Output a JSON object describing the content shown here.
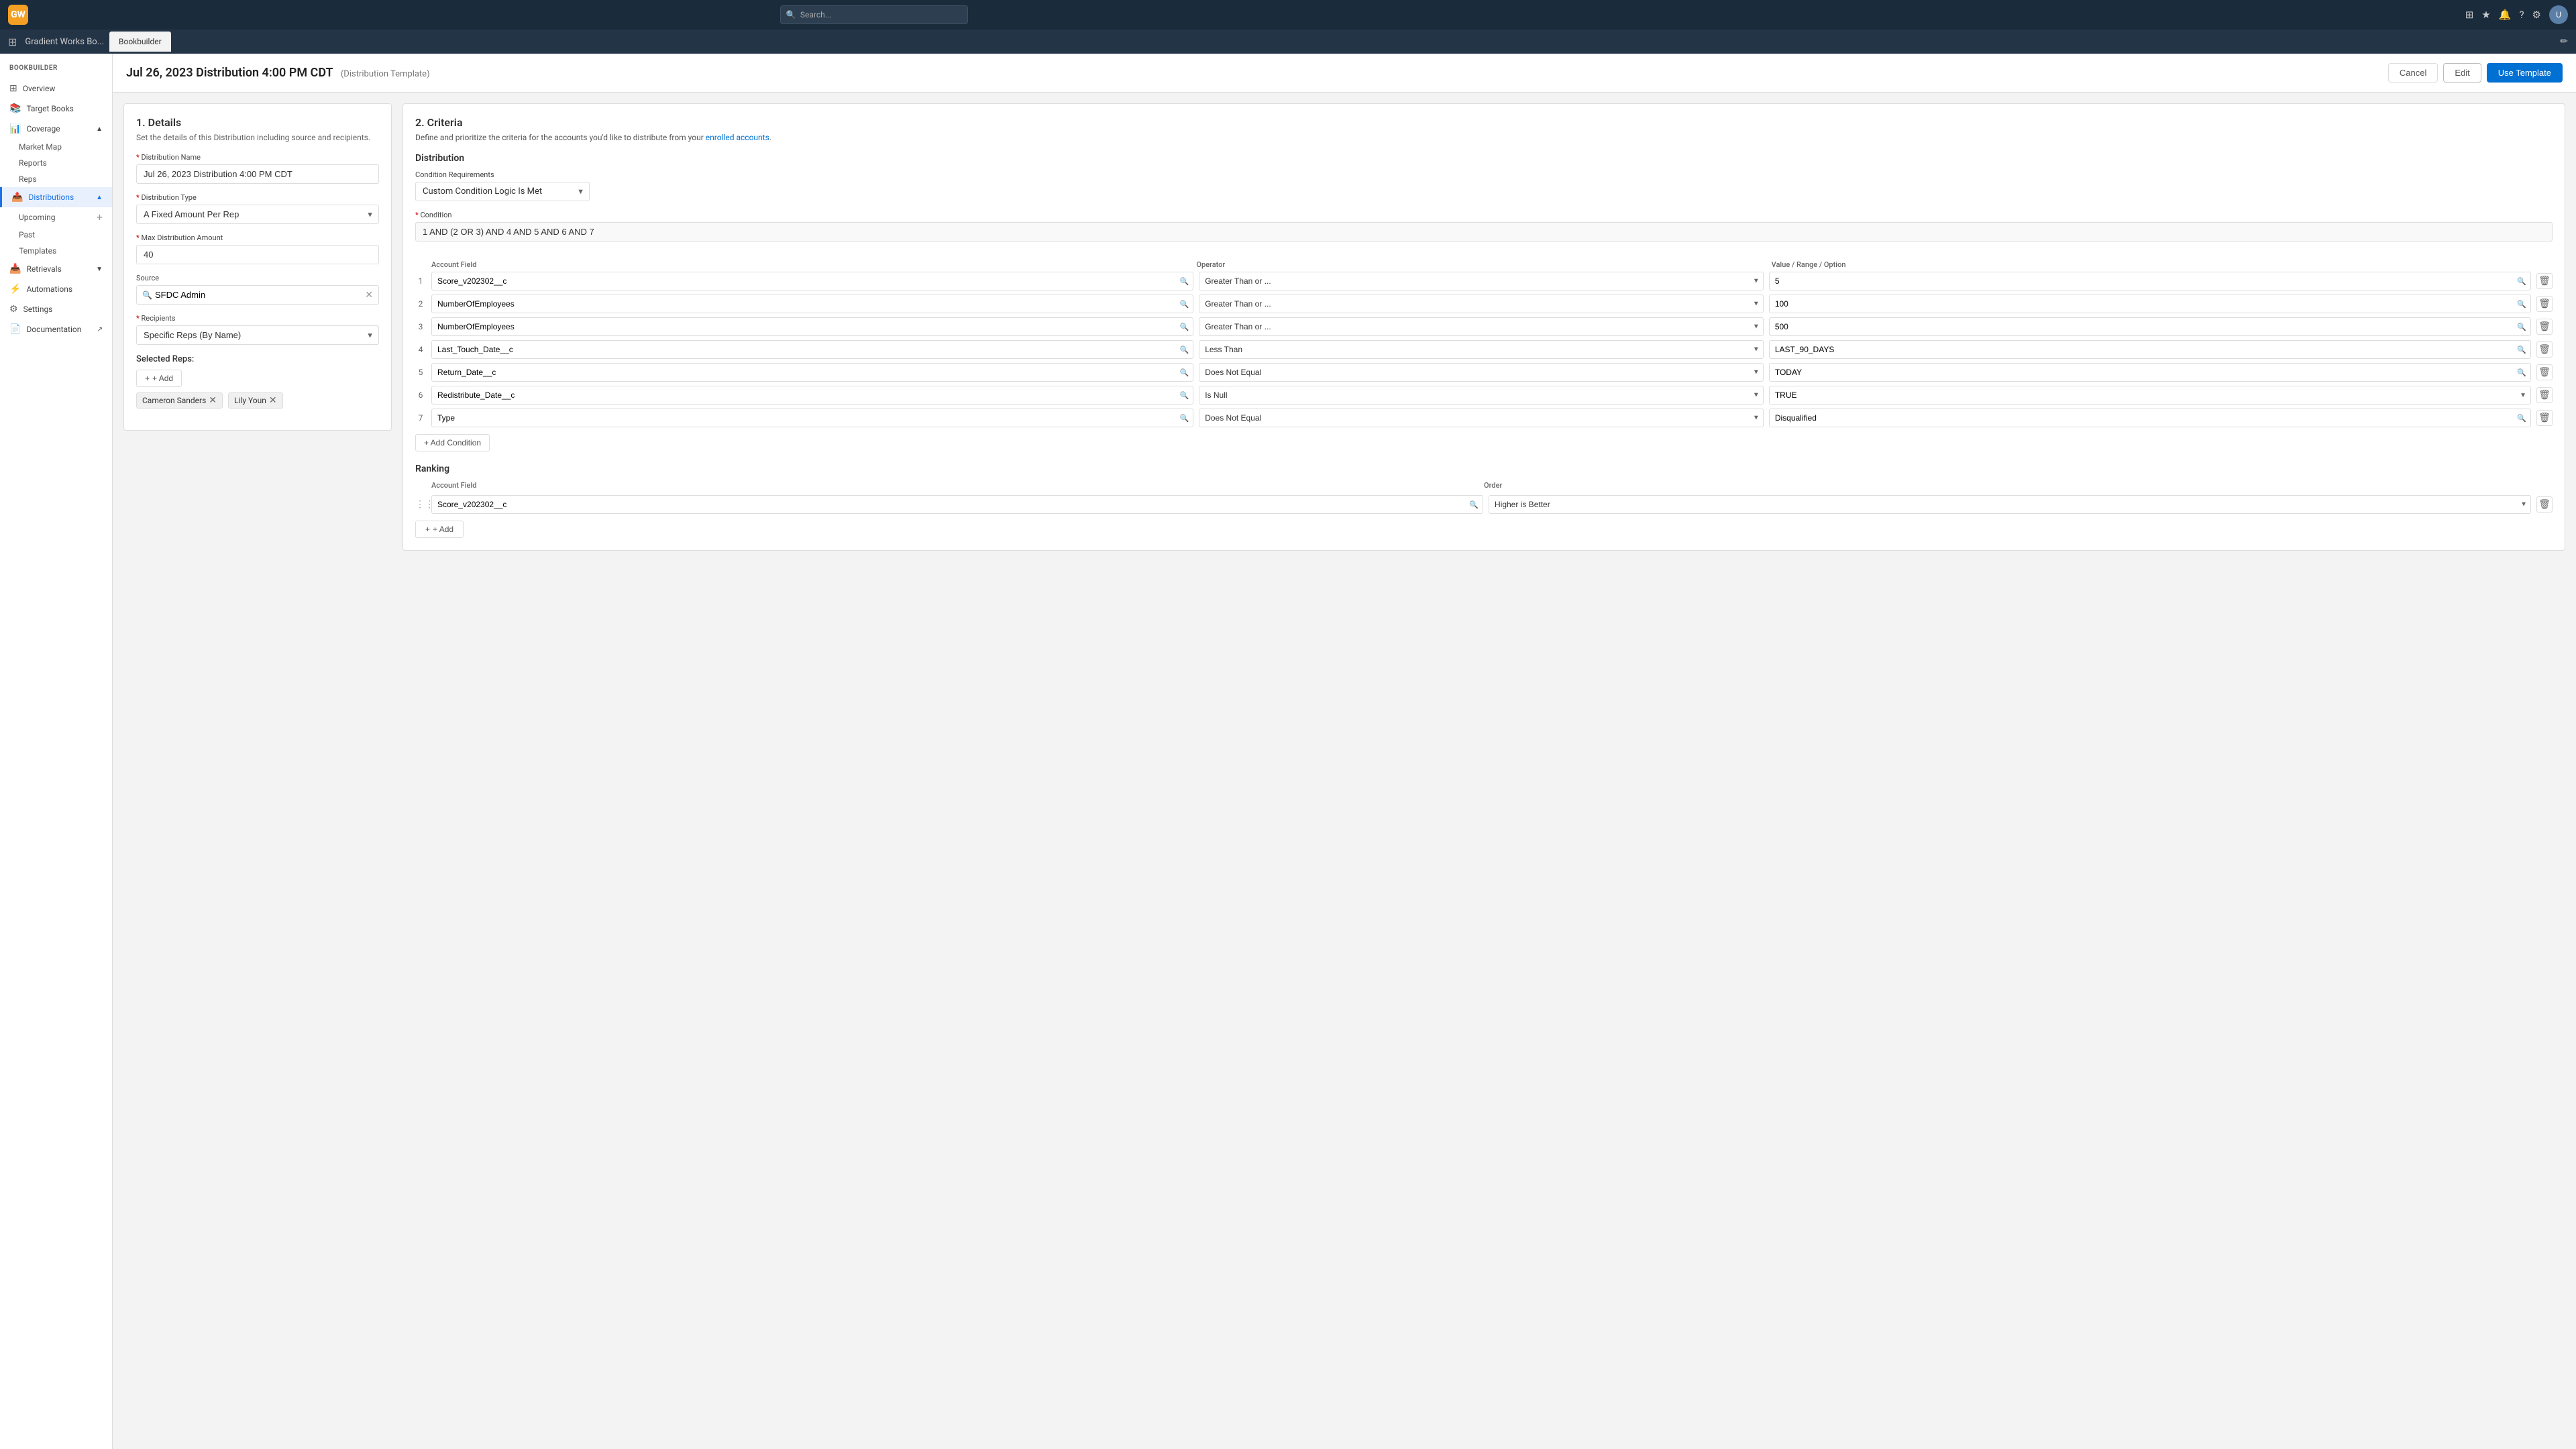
{
  "topNav": {
    "logoText": "GW",
    "searchPlaceholder": "Search...",
    "appName": "Gradient Works Bo...",
    "tabName": "Bookbuilder"
  },
  "header": {
    "title": "Jul 26, 2023 Distribution 4:00 PM CDT",
    "subtitle": "(Distribution Template)",
    "cancelLabel": "Cancel",
    "editLabel": "Edit",
    "useTemplateLabel": "Use Template"
  },
  "sidebar": {
    "heading": "BOOKBUILDER",
    "items": [
      {
        "id": "overview",
        "label": "Overview",
        "icon": "⊞"
      },
      {
        "id": "target-books",
        "label": "Target Books",
        "icon": "📚"
      },
      {
        "id": "coverage",
        "label": "Coverage",
        "icon": "📊",
        "expanded": true,
        "children": [
          {
            "id": "market-map",
            "label": "Market Map"
          },
          {
            "id": "reports",
            "label": "Reports"
          },
          {
            "id": "reps",
            "label": "Reps"
          }
        ]
      },
      {
        "id": "distributions",
        "label": "Distributions",
        "icon": "📤",
        "active": true,
        "expanded": true,
        "children": [
          {
            "id": "upcoming",
            "label": "Upcoming"
          },
          {
            "id": "past",
            "label": "Past"
          },
          {
            "id": "templates",
            "label": "Templates"
          }
        ]
      },
      {
        "id": "retrievals",
        "label": "Retrievals",
        "icon": "📥"
      },
      {
        "id": "automations",
        "label": "Automations",
        "icon": "⚡"
      },
      {
        "id": "settings",
        "label": "Settings",
        "icon": "⚙"
      },
      {
        "id": "documentation",
        "label": "Documentation",
        "icon": "📄"
      }
    ]
  },
  "details": {
    "sectionNum": "1.",
    "sectionTitle": "Details",
    "sectionDesc": "Set the details of this Distribution including source and recipients.",
    "distNameLabel": "Distribution Name",
    "distNameValue": "Jul 26, 2023 Distribution 4:00 PM CDT",
    "distTypeLabel": "Distribution Type",
    "distTypeValue": "A Fixed Amount Per Rep",
    "maxAmountLabel": "Max Distribution Amount",
    "maxAmountValue": "40",
    "sourceLabel": "Source",
    "sourceValue": "SFDC Admin",
    "recipientsLabel": "Recipients",
    "recipientsValue": "Specific Reps (By Name)",
    "selectedRepsLabel": "Selected Reps:",
    "addLabel": "+ Add",
    "reps": [
      {
        "name": "Cameron Sanders"
      },
      {
        "name": "Lily Youn"
      }
    ]
  },
  "criteria": {
    "sectionNum": "2.",
    "sectionTitle": "Criteria",
    "sectionDesc": "Define and prioritize the criteria for the accounts you'd like to distribute from your",
    "sectionDescLink": "enrolled accounts",
    "distributionLabel": "Distribution",
    "conditionReqLabel": "Condition Requirements",
    "conditionReqValue": "Custom Condition Logic Is Met",
    "conditionLabel": "Condition",
    "conditionValue": "1 AND (2 OR 3) AND 4 AND 5 AND 6 AND 7",
    "colAccountField": "Account Field",
    "colOperator": "Operator",
    "colValueRange": "Value",
    "conditions": [
      {
        "num": "1",
        "accountField": "Score_v202302__c",
        "operator": "Greater Than or ...",
        "valueLabel": "Value",
        "value": "5"
      },
      {
        "num": "2",
        "accountField": "NumberOfEmployees",
        "operator": "Greater Than or ...",
        "valueLabel": "Value",
        "value": "100"
      },
      {
        "num": "3",
        "accountField": "NumberOfEmployees",
        "operator": "Greater Than or ...",
        "valueLabel": "Value",
        "value": "500"
      },
      {
        "num": "4",
        "accountField": "Last_Touch_Date__c",
        "operator": "Less Than",
        "valueLabel": "Range",
        "value": "LAST_90_DAYS"
      },
      {
        "num": "5",
        "accountField": "Return_Date__c",
        "operator": "Does Not Equal",
        "valueLabel": "Range",
        "value": "TODAY"
      },
      {
        "num": "6",
        "accountField": "Redistribute_Date__c",
        "operator": "Is Null",
        "valueLabel": "Option",
        "valueType": "select",
        "value": "TRUE"
      },
      {
        "num": "7",
        "accountField": "Type",
        "operator": "Does Not Equal",
        "valueLabel": "Option",
        "valueType": "search",
        "value": "Disqualified"
      }
    ],
    "addConditionLabel": "+ Add Condition",
    "rankingLabel": "Ranking",
    "rankingColField": "Account Field",
    "rankingColOrder": "Order",
    "rankingField": "Score_v202302__c",
    "rankingOrder": "Higher is Better",
    "addRankingLabel": "+ Add"
  }
}
